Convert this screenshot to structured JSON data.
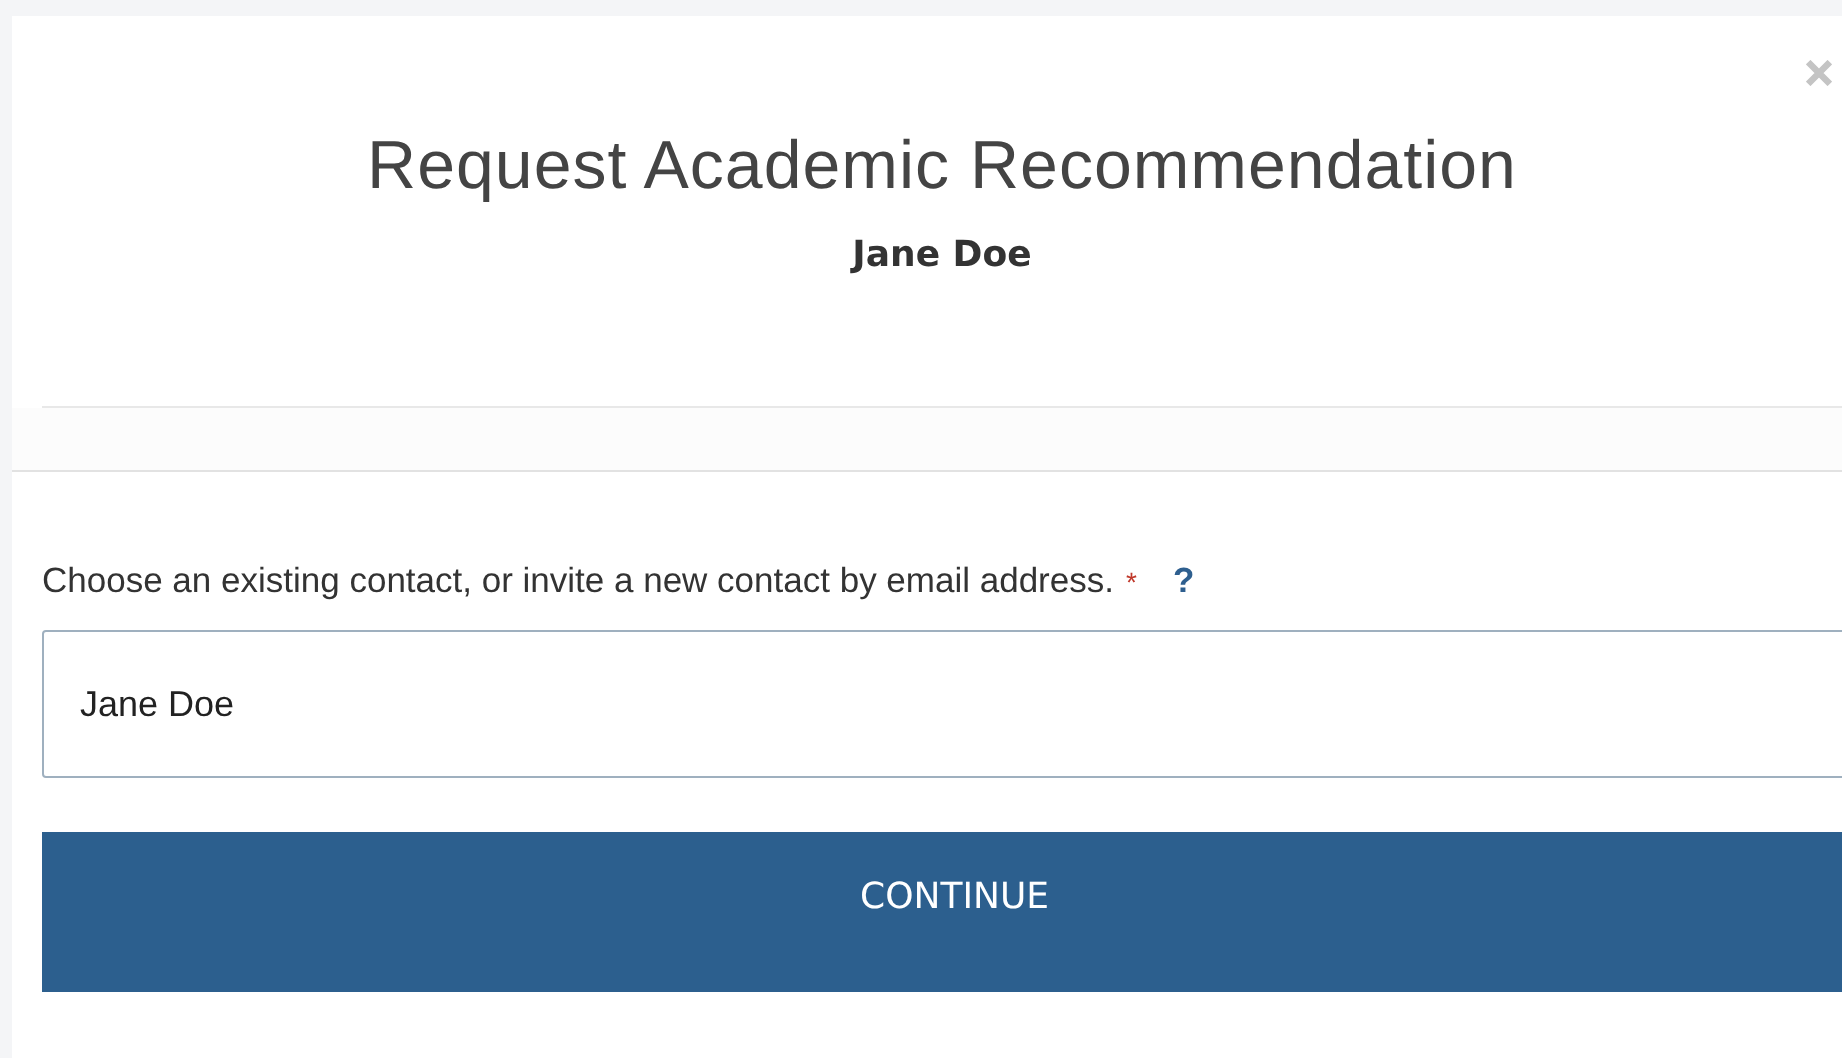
{
  "dialog": {
    "title": "Request Academic Recommendation",
    "subtitle": "Jane Doe"
  },
  "contact_field": {
    "label": "Choose an existing contact, or invite a new contact by email address.",
    "required_mark": "*",
    "help": "?",
    "value": "Jane Doe"
  },
  "buttons": [
    "CONTINUE"
  ]
}
